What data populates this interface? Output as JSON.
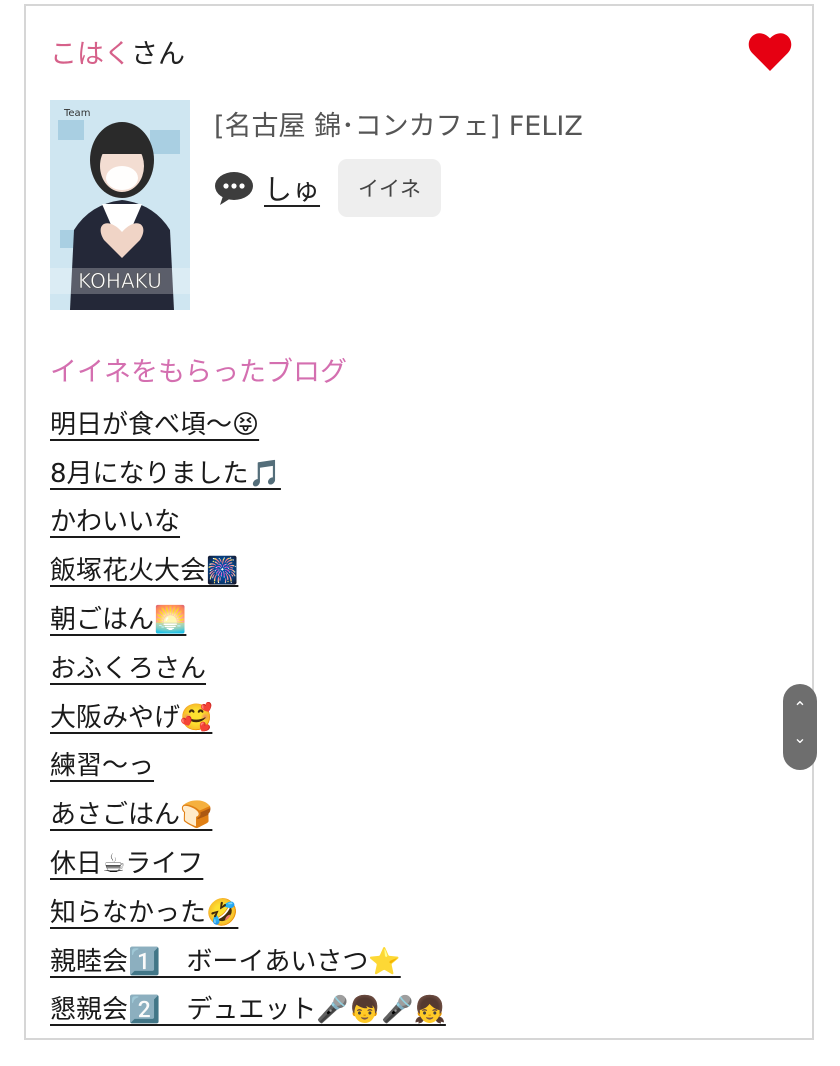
{
  "header": {
    "name": "こはく",
    "suffix": "さん"
  },
  "profile": {
    "shop": "[名古屋 錦･コンカフェ]  FELIZ",
    "staff_name": "しゅ",
    "like_button": "イイネ",
    "photo_caption": "KOHAKU",
    "photo_logo": "Team"
  },
  "section": {
    "title": "イイネをもらったブログ"
  },
  "blogs": [
    "明日が食べ頃〜😝",
    "8月になりました🎵",
    "かわいいな",
    "飯塚花火大会🎆",
    "朝ごはん🌅",
    "おふくろさん",
    "大阪みやげ🥰",
    "練習〜っ",
    "あさごはん🍞",
    "休日☕ライフ",
    "知らなかった🤣",
    "親睦会1️⃣　ボーイあいさつ⭐",
    "懇親会2️⃣　デュエット🎤👦🎤👧"
  ],
  "scroll": {
    "up": "⌃",
    "down": "⌄"
  },
  "colors": {
    "accent_pink": "#d6618a",
    "section_pink": "#d46fb0",
    "heart": "#e60012"
  },
  "icons": [
    "heart-icon",
    "comment-icon",
    "scroll-up-icon",
    "scroll-down-icon"
  ]
}
